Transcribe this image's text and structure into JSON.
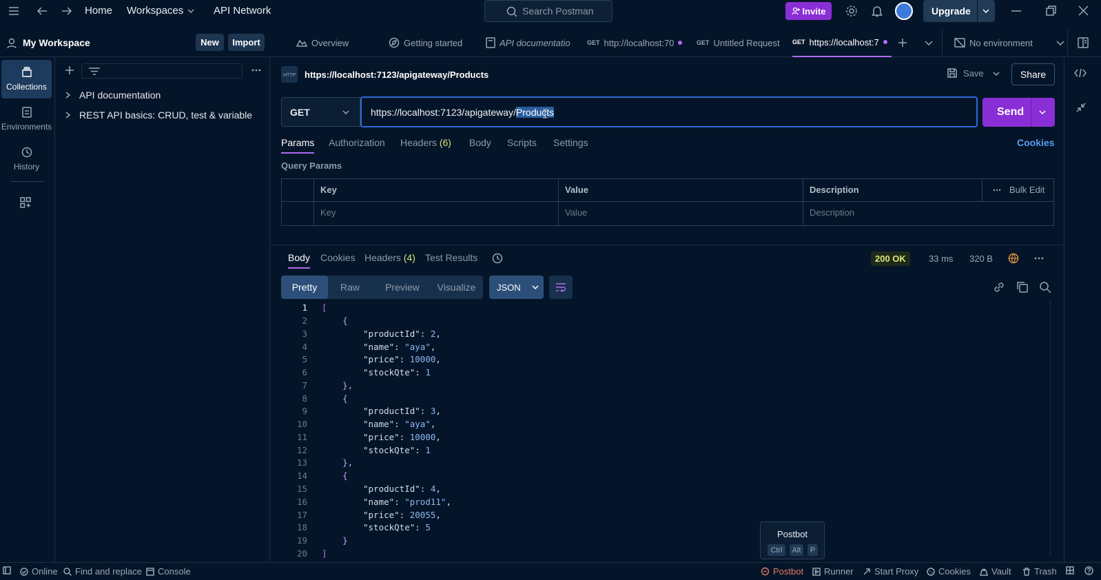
{
  "topbar": {
    "home": "Home",
    "workspaces": "Workspaces",
    "api_network": "API Network",
    "search_placeholder": "Search Postman",
    "invite": "Invite",
    "upgrade": "Upgrade"
  },
  "workspace": {
    "name": "My Workspace",
    "new_label": "New",
    "import_label": "Import"
  },
  "rail": {
    "collections": "Collections",
    "environments": "Environments",
    "history": "History"
  },
  "tree": {
    "items": [
      "API documentation",
      "REST API basics: CRUD, test & variable"
    ]
  },
  "tabs": [
    {
      "method": "",
      "label": "Overview"
    },
    {
      "method": "",
      "label": "Getting started"
    },
    {
      "method": "",
      "label": "API documentatio"
    },
    {
      "method": "GET",
      "label": "http://localhost:70"
    },
    {
      "method": "GET",
      "label": "Untitled Request"
    },
    {
      "method": "GET",
      "label": "https://localhost:7"
    }
  ],
  "environment": "No environment",
  "request": {
    "title": "https://localhost:7123/apigateway/Products",
    "save_label": "Save",
    "share_label": "Share",
    "method": "GET",
    "url_prefix": "https://localhost:7123/apigateway/",
    "url_selected": "Products",
    "send_label": "Send",
    "subtabs": {
      "params": "Params",
      "authorization": "Authorization",
      "headers": "Headers",
      "headers_count": "(6)",
      "body": "Body",
      "scripts": "Scripts",
      "settings": "Settings",
      "cookies": "Cookies"
    },
    "query_params_label": "Query Params",
    "columns": {
      "key": "Key",
      "value": "Value",
      "description": "Description",
      "bulk_edit": "Bulk Edit"
    },
    "placeholders": {
      "key": "Key",
      "value": "Value",
      "description": "Description"
    }
  },
  "response": {
    "tabs": {
      "body": "Body",
      "cookies": "Cookies",
      "headers": "Headers",
      "headers_count": "(4)",
      "test_results": "Test Results"
    },
    "status": "200 OK",
    "time": "33 ms",
    "size": "320 B",
    "views": [
      "Pretty",
      "Raw",
      "Preview",
      "Visualize"
    ],
    "format": "JSON",
    "lines": [
      "1",
      "2",
      "3",
      "4",
      "5",
      "6",
      "7",
      "8",
      "9",
      "10",
      "11",
      "12",
      "13",
      "14",
      "15",
      "16",
      "17",
      "18",
      "19",
      "20"
    ],
    "products": [
      {
        "productId": "2",
        "name": "\"aya\"",
        "price": "10000",
        "stockQte": "1"
      },
      {
        "productId": "3",
        "name": "\"aya\"",
        "price": "10000",
        "stockQte": "1"
      },
      {
        "productId": "4",
        "name": "\"prod11\"",
        "price": "20055",
        "stockQte": "5"
      }
    ],
    "keys": {
      "productId": "\"productId\"",
      "name": "\"name\"",
      "price": "\"price\"",
      "stockQte": "\"stockQte\""
    }
  },
  "postbot_tip": {
    "title": "Postbot",
    "keys": [
      "Ctrl",
      "Alt",
      "P"
    ]
  },
  "statusbar": {
    "online": "Online",
    "find_replace": "Find and replace",
    "console": "Console",
    "postbot": "Postbot",
    "runner": "Runner",
    "start_proxy": "Start Proxy",
    "cookies": "Cookies",
    "vault": "Vault",
    "trash": "Trash"
  },
  "colors": {
    "accent": "#8a2fd6",
    "status_ok": "#d8e57a",
    "background": "#051529"
  }
}
